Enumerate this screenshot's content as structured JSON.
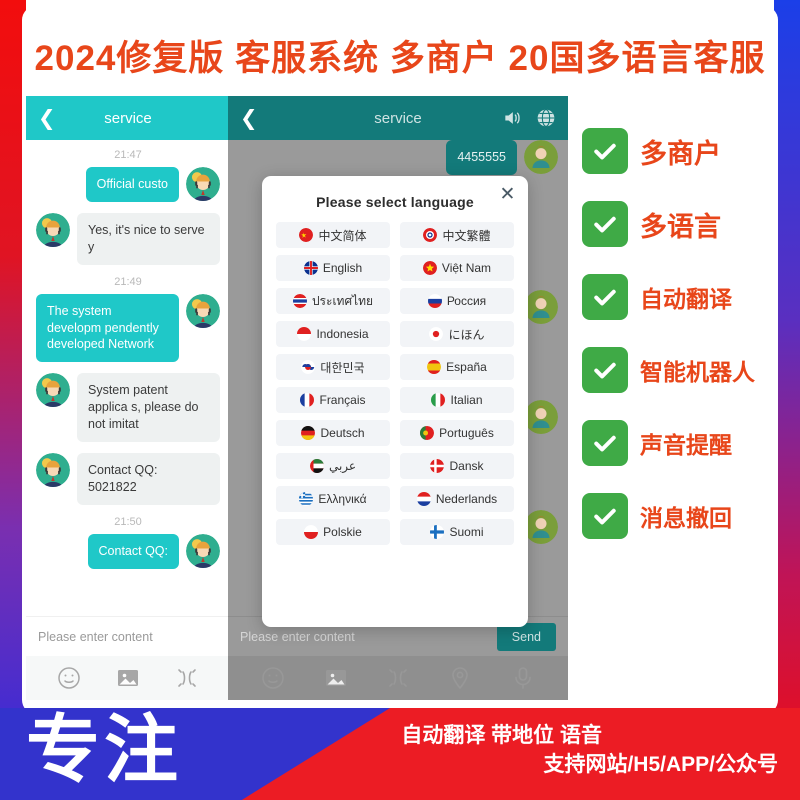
{
  "headline": "2024修复版 客服系统 多商户 20国多语言客服",
  "colors": {
    "accent_orange": "#e8461a",
    "teal": "#1fc8c8",
    "teal_dim": "#137a7a",
    "green": "#3faa46",
    "banner_red": "#ec1c24",
    "banner_blue": "#3333cc"
  },
  "phone_a": {
    "back_icon": "chevron-left-icon",
    "title": "service",
    "messages": [
      {
        "kind": "timestamp",
        "text": "21:47"
      },
      {
        "kind": "out",
        "text": "Official custo"
      },
      {
        "kind": "in",
        "text": "Yes, it's nice to serve y"
      },
      {
        "kind": "timestamp",
        "text": "21:49"
      },
      {
        "kind": "out",
        "text": "The system developm pendently developed Network"
      },
      {
        "kind": "in",
        "text": "System patent applica s, please do not imitat"
      },
      {
        "kind": "in",
        "text": "Contact QQ: 5021822"
      },
      {
        "kind": "timestamp",
        "text": "21:50"
      },
      {
        "kind": "out",
        "text": "Contact QQ:"
      }
    ],
    "input_placeholder": "Please enter content",
    "tools": [
      "emoji-icon",
      "image-icon",
      "sticker-icon"
    ]
  },
  "phone_b": {
    "back_icon": "chevron-left-icon",
    "title": "service",
    "header_icons": [
      "speaker-icon",
      "globe-icon"
    ],
    "messages": [
      {
        "kind": "out",
        "text": "4455555"
      }
    ],
    "input_placeholder": "Please enter content",
    "send_label": "Send",
    "tools": [
      "emoji-icon",
      "image-icon",
      "sticker-icon",
      "location-icon",
      "microphone-icon"
    ]
  },
  "language_dialog": {
    "title": "Please select language",
    "close_icon": "close-icon",
    "languages": [
      {
        "label": "中文简体",
        "flag": "cn"
      },
      {
        "label": "中文繁體",
        "flag": "tw"
      },
      {
        "label": "English",
        "flag": "gb"
      },
      {
        "label": "Việt Nam",
        "flag": "vn"
      },
      {
        "label": "ประเทศไทย",
        "flag": "th"
      },
      {
        "label": "Россия",
        "flag": "ru"
      },
      {
        "label": "Indonesia",
        "flag": "id"
      },
      {
        "label": "にほん",
        "flag": "jp"
      },
      {
        "label": "대한민국",
        "flag": "kr"
      },
      {
        "label": "España",
        "flag": "es"
      },
      {
        "label": "Français",
        "flag": "fr"
      },
      {
        "label": "Italian",
        "flag": "it"
      },
      {
        "label": "Deutsch",
        "flag": "de"
      },
      {
        "label": "Português",
        "flag": "pt"
      },
      {
        "label": "عربي",
        "flag": "ae"
      },
      {
        "label": "Dansk",
        "flag": "dk"
      },
      {
        "label": "Ελληνικά",
        "flag": "gr"
      },
      {
        "label": "Nederlands",
        "flag": "nl"
      },
      {
        "label": "Polskie",
        "flag": "pl"
      },
      {
        "label": "Suomi",
        "flag": "fi"
      }
    ]
  },
  "features": [
    {
      "label": "多商户",
      "icon": "check-icon"
    },
    {
      "label": "多语言",
      "icon": "check-icon"
    },
    {
      "label": "自动翻译",
      "icon": "check-icon"
    },
    {
      "label": "智能机器人",
      "icon": "check-icon"
    },
    {
      "label": "声音提醒",
      "icon": "check-icon"
    },
    {
      "label": "消息撤回",
      "icon": "check-icon"
    }
  ],
  "banner": {
    "badge": "专注",
    "line1": "自动翻译 带地位 语音",
    "line2": "支持网站/H5/APP/公众号"
  }
}
